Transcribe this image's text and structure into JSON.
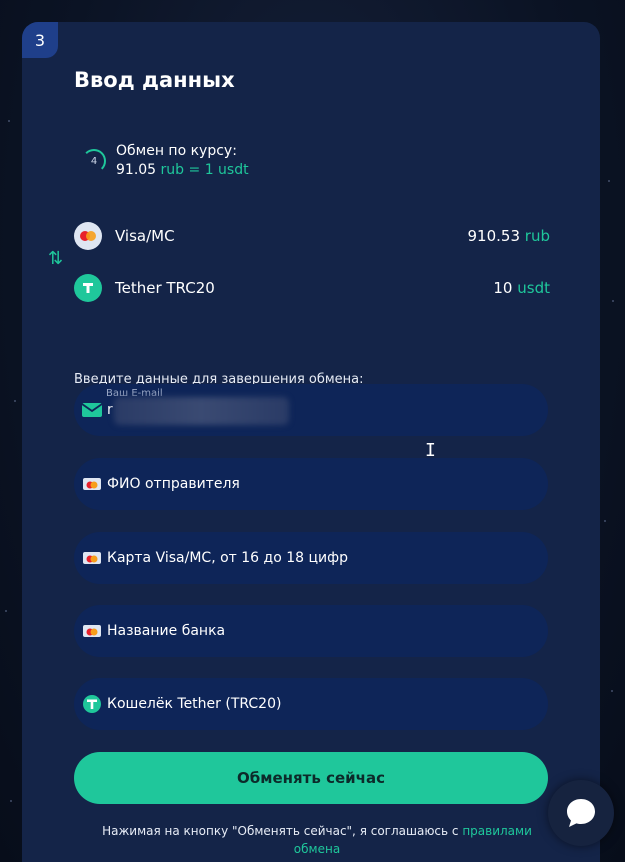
{
  "step_number": "3",
  "title": "Ввод данных",
  "rate": {
    "timer_value": "4",
    "label": "Обмен по курсу:",
    "value": "91.05",
    "rub_unit": "rub",
    "equals": "= 1 usdt"
  },
  "from": {
    "name": "Visa/MC",
    "amount": "910.53",
    "currency": "rub",
    "icon": "visa-mc-icon"
  },
  "to": {
    "name": "Tether TRC20",
    "amount": "10",
    "currency": "usdt",
    "icon": "tether-icon"
  },
  "form_prompt": "Введите данные для завершения обмена:",
  "fields": {
    "email_label": "Ваш E-mail",
    "email_value": "r",
    "sender_name_placeholder": "ФИО отправителя",
    "card_placeholder": "Карта Visa/MC, от 16 до 18 цифр",
    "bank_placeholder": "Название банка",
    "wallet_placeholder": "Кошелёк Tether (TRC20)"
  },
  "submit_label": "Обменять сейчас",
  "terms": {
    "text": "Нажимая на кнопку \"Обменять сейчас\", я соглашаюсь с ",
    "link_part1": "правилами",
    "link_part2": "обмена"
  },
  "colors": {
    "accent": "#1fc79b",
    "card_bg": "#142448",
    "field_bg": "#0e2558"
  }
}
